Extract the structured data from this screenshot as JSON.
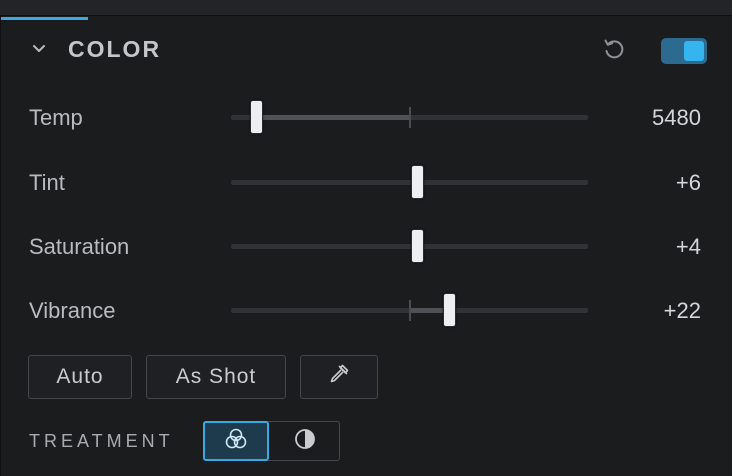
{
  "section": {
    "title": "COLOR",
    "collapse_icon": "chevron-down-icon",
    "reset_icon": "reset-icon",
    "enabled": true,
    "accent_color": "#36b4ef"
  },
  "sliders": [
    {
      "label": "Temp",
      "value": "5480",
      "position": 0.07,
      "center": 0.5
    },
    {
      "label": "Tint",
      "value": "+6",
      "position": 0.52
    },
    {
      "label": "Saturation",
      "value": "+4",
      "position": 0.52
    },
    {
      "label": "Vibrance",
      "value": "+22",
      "position": 0.61,
      "center": 0.5
    }
  ],
  "buttons": {
    "auto": "Auto",
    "as_shot": "As Shot",
    "eyedropper_icon": "eyedropper-icon"
  },
  "treatment": {
    "label": "TREATMENT",
    "options": [
      {
        "icon": "color-treatment-icon",
        "active": true
      },
      {
        "icon": "black-white-treatment-icon",
        "active": false
      }
    ]
  }
}
